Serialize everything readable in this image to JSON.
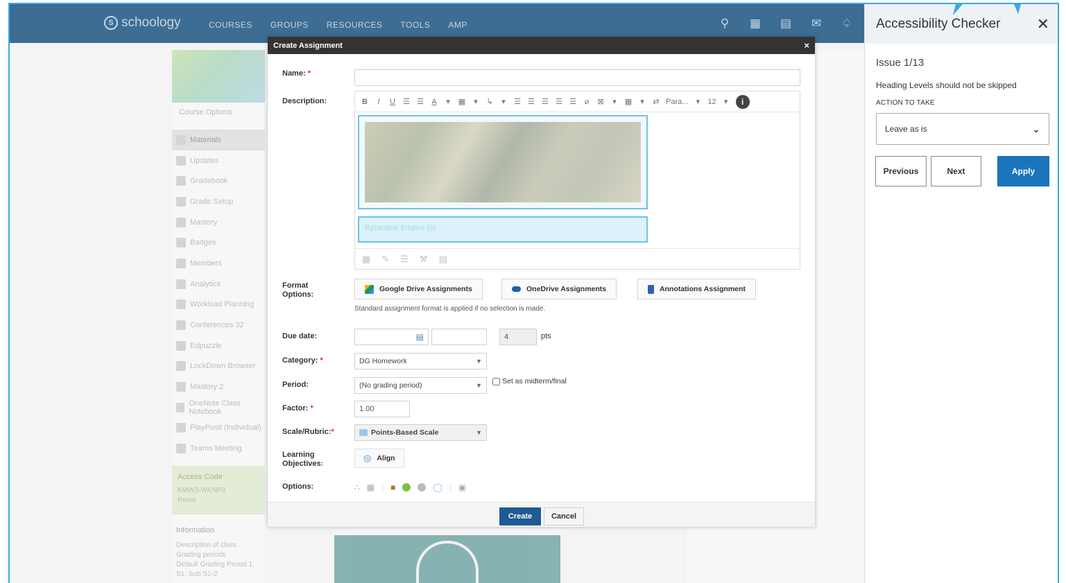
{
  "app": {
    "logo_text": "schoology",
    "nav": [
      "COURSES",
      "GROUPS",
      "RESOURCES",
      "TOOLS",
      "AMP"
    ]
  },
  "sidebar": {
    "course_options": "Course Options",
    "items": [
      {
        "label": "Materials",
        "active": true
      },
      {
        "label": "Updates"
      },
      {
        "label": "Gradebook"
      },
      {
        "label": "Grade Setup"
      },
      {
        "label": "Mastery"
      },
      {
        "label": "Badges"
      },
      {
        "label": "Members"
      },
      {
        "label": "Analytics"
      },
      {
        "label": "Workload Planning"
      },
      {
        "label": "Conferences 32"
      },
      {
        "label": "Edpuzzle"
      },
      {
        "label": "LockDown Browser"
      },
      {
        "label": "Mastery 2"
      },
      {
        "label": "OneNote Class Notebook"
      },
      {
        "label": "PlayPosit (Individual)"
      },
      {
        "label": "Teams Meeting"
      }
    ],
    "access_code_label": "Access Code",
    "access_code": "KMW3-WKNP3",
    "reset": "Reset",
    "information_label": "Information",
    "description": "Description of class",
    "grading_periods": "Grading periods",
    "grading_period_values": "Default Grading Period 1, S1, Sub S1-2"
  },
  "modal": {
    "title": "Create Assignment",
    "close": "×",
    "name_label": "Name:",
    "name_value": "",
    "description_label": "Description:",
    "toolbar": [
      "B",
      "I",
      "U",
      "☰",
      "☰",
      "A",
      "▾",
      "▦",
      "▾",
      "↳",
      "▾",
      "☰",
      "☰",
      "☰",
      "☰",
      "☰",
      "⌀",
      "⊠",
      "▾",
      "▦",
      "▾",
      "⇄",
      "Para...",
      "▾",
      "12",
      "▾"
    ],
    "caption_text": "Byzantine Empire (6)",
    "format_label": "Format Options:",
    "format_buttons": [
      "Google Drive Assignments",
      "OneDrive Assignments",
      "Annotations Assignment"
    ],
    "format_note": "Standard assignment format is applied if no selection is made.",
    "due_label": "Due date:",
    "points_value": "4",
    "points_unit": "pts",
    "category_label": "Category:",
    "category_value": "DG Homework",
    "period_label": "Period:",
    "period_value": "(No grading period)",
    "midterm_label": "Set as midterm/final",
    "factor_label": "Factor:",
    "factor_value": "1.00",
    "scale_label": "Scale/Rubric:",
    "scale_value": "Points-Based Scale",
    "objectives_label": "Learning Objectives:",
    "align_label": "Align",
    "options_label": "Options:",
    "create_label": "Create",
    "cancel_label": "Cancel"
  },
  "checker": {
    "title": "Accessibility Checker",
    "close": "✕",
    "issue": "Issue 1/13",
    "description": "Heading Levels should not be skipped",
    "action_label": "ACTION TO TAKE",
    "action_value": "Leave as is",
    "previous": "Previous",
    "next": "Next",
    "apply": "Apply"
  },
  "colors": {
    "nav_bg": "#3d6d93",
    "frame": "#39a9dc",
    "create_btn": "#1e5a94",
    "apply_btn": "#1a75bc"
  }
}
